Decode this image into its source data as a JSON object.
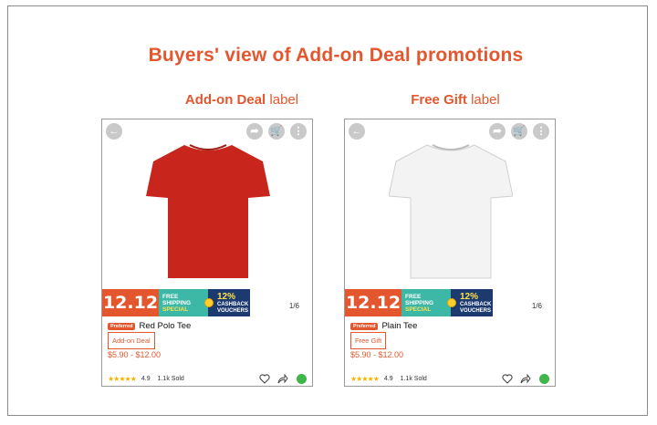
{
  "title": "Buyers' view of Add-on Deal promotions",
  "columns": [
    {
      "label_bold": "Add-on Deal",
      "label_rest": " label",
      "product": {
        "shirt_color": "#c8261c",
        "banner_1212": "12.12",
        "banner_ship_1": "FREE",
        "banner_ship_2": "SHIPPING",
        "banner_ship_3": "SPECIAL",
        "banner_pct": "12%",
        "banner_cash_1": "CASHBACK",
        "banner_cash_2": "VOUCHERS",
        "pager": "1/6",
        "preferred_badge": "Preferred",
        "name": "Red Polo Tee",
        "tag": "Add-on Deal",
        "price": "$5.90 - $12.00",
        "stars": "★★★★★",
        "rating": "4.9",
        "sold": "1.1k Sold"
      }
    },
    {
      "label_bold": "Free Gift",
      "label_rest": " label",
      "product": {
        "shirt_color": "#f4f4f4",
        "banner_1212": "12.12",
        "banner_ship_1": "FREE",
        "banner_ship_2": "SHIPPING",
        "banner_ship_3": "SPECIAL",
        "banner_pct": "12%",
        "banner_cash_1": "CASHBACK",
        "banner_cash_2": "VOUCHERS",
        "pager": "1/6",
        "preferred_badge": "Preferred",
        "name": "Plain Tee",
        "tag": "Free Gift",
        "price": "$5.90 - $12.00",
        "stars": "★★★★★",
        "rating": "4.9",
        "sold": "1.1k Sold"
      }
    }
  ],
  "icons": {
    "back": "back-arrow-icon",
    "share": "share-icon",
    "cart": "cart-icon",
    "more": "more-icon",
    "heart": "heart-icon",
    "share_footer": "share-icon",
    "chat": "whatsapp-icon"
  },
  "colors": {
    "accent": "#e4572e",
    "teal": "#3db8a6",
    "navy": "#1d3a70",
    "star": "#f5b400"
  }
}
